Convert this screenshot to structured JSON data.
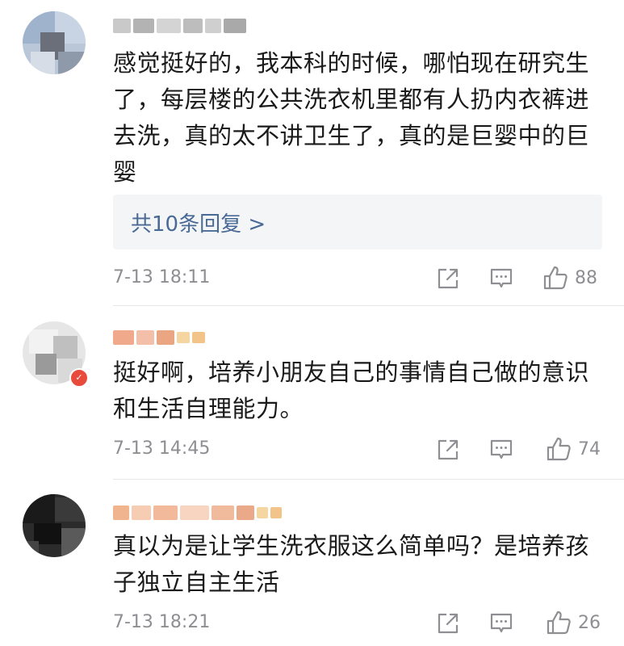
{
  "comments": [
    {
      "text": "感觉挺好的，我本科的时候，哪怕现在研究生了，每层楼的公共洗衣机里都有人扔内衣裤进去洗，真的太不讲卫生了，真的是巨婴中的巨婴",
      "replies_label": "共10条回复 >",
      "time": "7-13 18:11",
      "likes": "88"
    },
    {
      "text": "挺好啊，培养小朋友自己的事情自己做的意识和生活自理能力。",
      "time": "7-13 14:45",
      "likes": "74"
    },
    {
      "text": "真以为是让学生洗衣服这么简单吗？是培养孩子独立自主生活",
      "time": "7-13 18:21",
      "likes": "26"
    }
  ],
  "icons": {
    "share": "share-icon",
    "comment": "comment-icon",
    "like": "thumbs-up-icon"
  },
  "colors": {
    "reply_link": "#4a6a96",
    "meta_text": "#8e8e93",
    "reply_bg": "#f4f5f7"
  }
}
